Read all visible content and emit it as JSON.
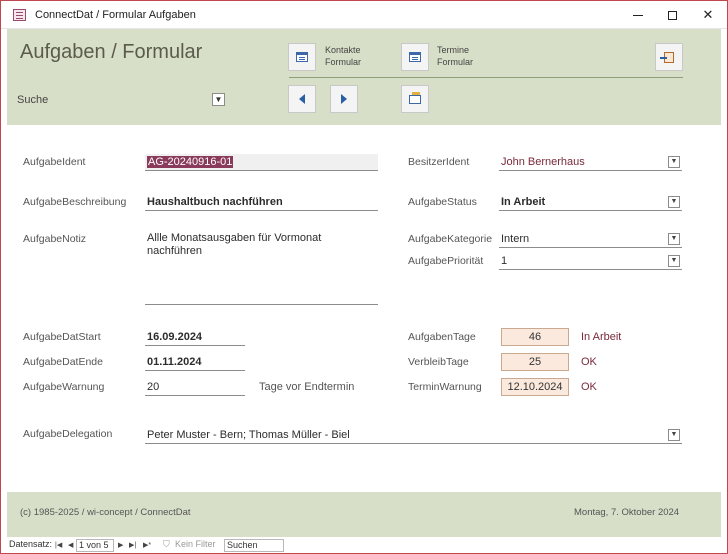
{
  "window": {
    "title": "ConnectDat / Formular Aufgaben"
  },
  "header": {
    "title": "Aufgaben / Formular",
    "search_label": "Suche",
    "kontakte_line1": "Kontakte",
    "kontakte_line2": "Formular",
    "termine_line1": "Termine",
    "termine_line2": "Formular"
  },
  "fields": {
    "ident_label": "AufgabeIdent",
    "ident_value": "AG-20240916-01",
    "beschreibung_label": "AufgabeBeschreibung",
    "beschreibung_value": "Haushaltbuch nachführen",
    "notiz_label": "AufgabeNotiz",
    "notiz_value": "Allle Monatsausgaben für Vormonat nachführen",
    "besitzer_label": "BesitzerIdent",
    "besitzer_value": "John Bernerhaus",
    "status_label": "AufgabeStatus",
    "status_value": "In Arbeit",
    "kategorie_label": "AufgabeKategorie",
    "kategorie_value": "Intern",
    "prioritaet_label": "AufgabePriorität",
    "prioritaet_value": "1",
    "start_label": "AufgabeDatStart",
    "start_value": "16.09.2024",
    "ende_label": "AufgabeDatEnde",
    "ende_value": "01.11.2024",
    "warnung_label": "AufgabeWarnung",
    "warnung_value": "20",
    "warnung_suffix": "Tage vor Endtermin",
    "tage_label": "AufgabenTage",
    "tage_value": "46",
    "tage_status": "In Arbeit",
    "verbleib_label": "VerbleibTage",
    "verbleib_value": "25",
    "verbleib_status": "OK",
    "terminwarnung_label": "TerminWarnung",
    "terminwarnung_value": "12.10.2024",
    "terminwarnung_status": "OK",
    "delegation_label": "AufgabeDelegation",
    "delegation_value": "Peter Muster - Bern; Thomas Müller - Biel"
  },
  "footer": {
    "copyright": "(c) 1985-2025 / wi-concept / ConnectDat",
    "date": "Montag, 7. Oktober 2024"
  },
  "record_nav": {
    "label": "Datensatz:",
    "position": "1 von 5",
    "filter": "Kein Filter",
    "search": "Suchen"
  },
  "colors": {
    "header_bg": "#d8dfc8",
    "accent_maroon": "#7a2a3a",
    "number_box_bg": "#fbe9de",
    "border_red": "#c0474f"
  },
  "icons": {
    "app": "form-app-icon",
    "kontakte": "form-icon",
    "termine": "form-icon",
    "prev": "arrow-left-icon",
    "next": "arrow-right-icon",
    "new": "new-record-icon",
    "exit": "exit-door-icon"
  }
}
